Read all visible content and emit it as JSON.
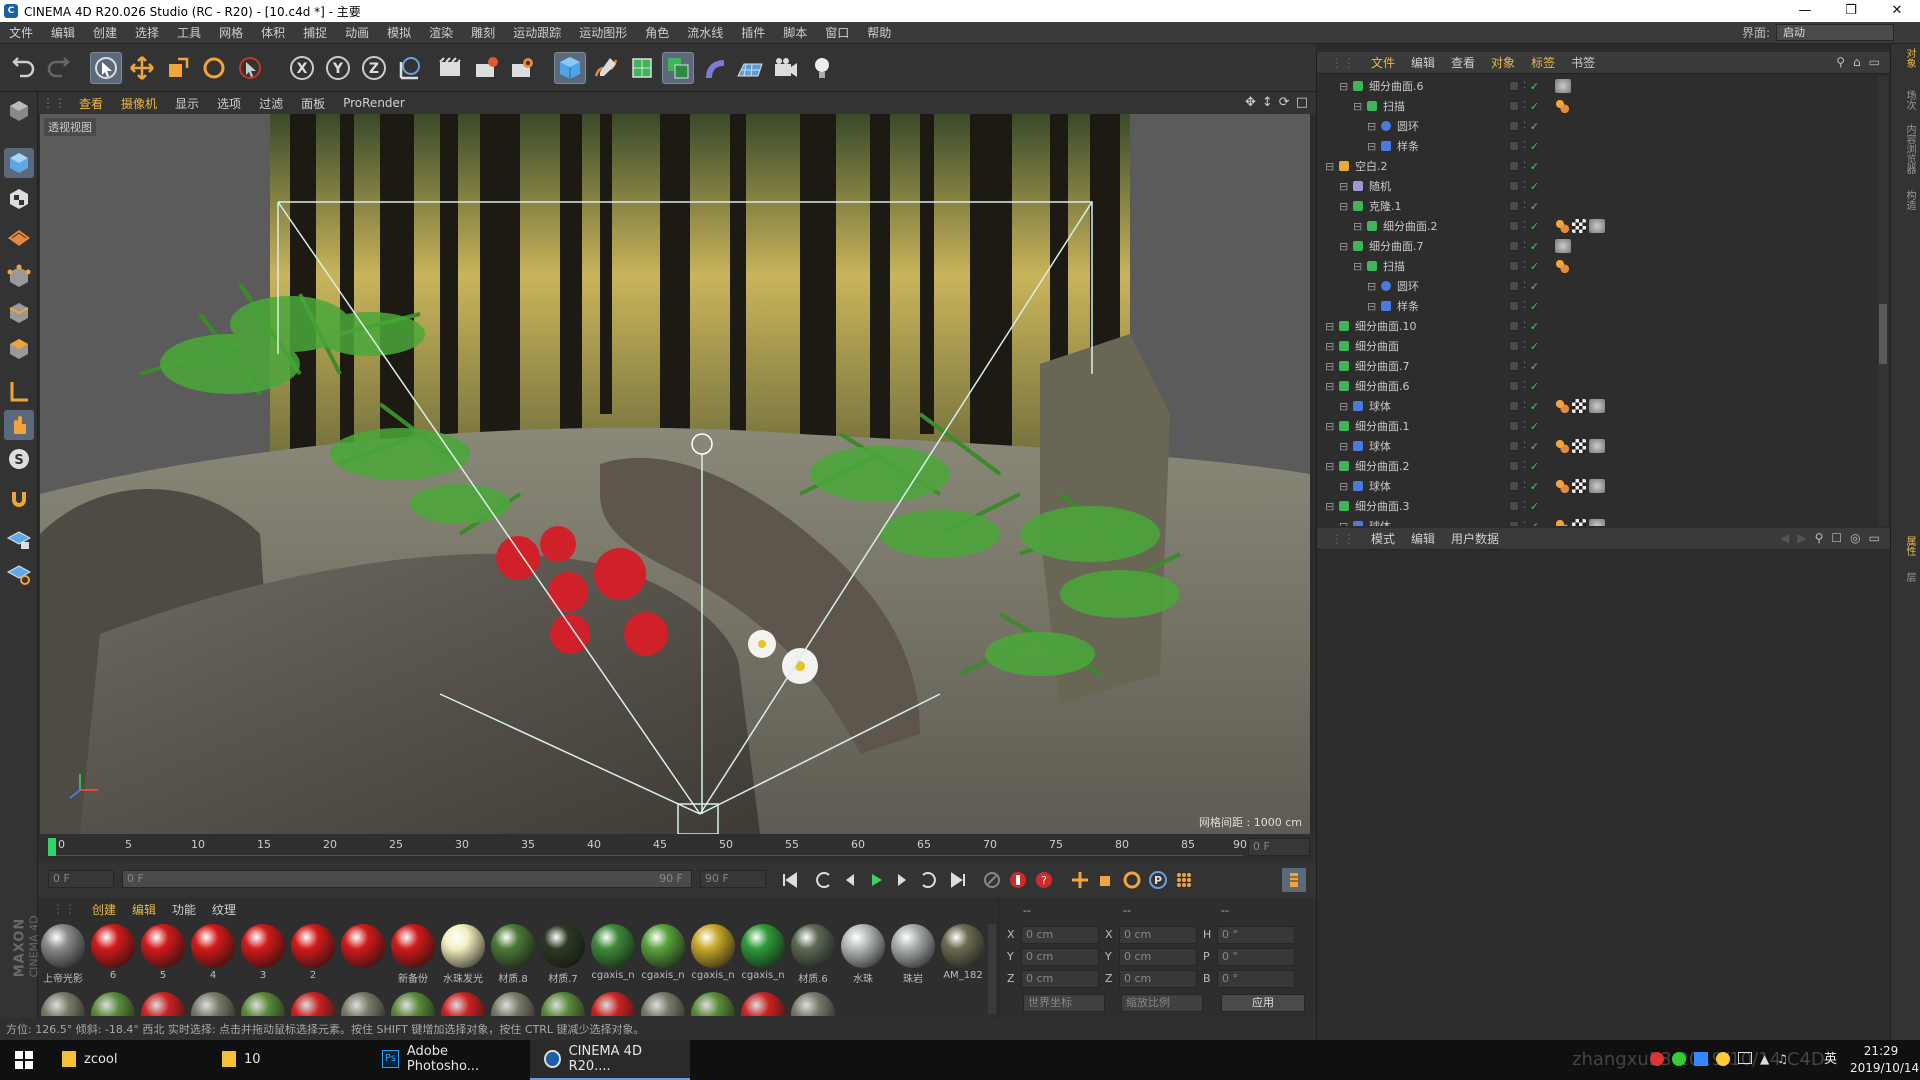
{
  "window": {
    "title": "CINEMA 4D R20.026 Studio (RC - R20) - [10.c4d *] - 主要"
  },
  "menubar": {
    "items": [
      "文件",
      "编辑",
      "创建",
      "选择",
      "工具",
      "网格",
      "体积",
      "捕捉",
      "动画",
      "模拟",
      "渲染",
      "雕刻",
      "运动跟踪",
      "运动图形",
      "角色",
      "流水线",
      "插件",
      "脚本",
      "窗口",
      "帮助"
    ],
    "layout_label": "界面:",
    "layout_value": "启动"
  },
  "viewport": {
    "menu": [
      "查看",
      "摄像机",
      "显示",
      "选项",
      "过滤",
      "面板",
      "ProRender"
    ],
    "label": "透视视图",
    "grid_info": "网格间距 : 1000 cm"
  },
  "timeline": {
    "ticks": [
      "0",
      "5",
      "10",
      "15",
      "20",
      "25",
      "30",
      "35",
      "40",
      "45",
      "50",
      "55",
      "60",
      "65",
      "70",
      "75",
      "80",
      "85",
      "90"
    ],
    "end_field": "0 F"
  },
  "transport": {
    "start_field": "0 F",
    "range_start": "0 F",
    "range_end": "90 F",
    "end_field": "90 F"
  },
  "materials": {
    "menu": [
      "创建",
      "编辑",
      "功能",
      "纹理"
    ],
    "items": [
      {
        "label": "上帝光影",
        "color": "#8a8a8a"
      },
      {
        "label": "6",
        "color": "#d21a1a"
      },
      {
        "label": "5",
        "color": "#d21a1a"
      },
      {
        "label": "4",
        "color": "#d21a1a"
      },
      {
        "label": "3",
        "color": "#d21a1a"
      },
      {
        "label": "2",
        "color": "#d21a1a"
      },
      {
        "label": "",
        "color": "#d21a1a"
      },
      {
        "label": "新备份",
        "color": "#d21a1a"
      },
      {
        "label": "水珠发光",
        "color": "#f4efc0"
      },
      {
        "label": "材质.8",
        "color": "#4c7a3a"
      },
      {
        "label": "材质.7",
        "color": "#2c3a22"
      },
      {
        "label": "cgaxis_n",
        "color": "#3f8a3a"
      },
      {
        "label": "cgaxis_n",
        "color": "#5aa33e"
      },
      {
        "label": "cgaxis_n",
        "color": "#c9a92a"
      },
      {
        "label": "cgaxis_n",
        "color": "#2f9a3a"
      },
      {
        "label": "材质.6",
        "color": "#5b6a55"
      },
      {
        "label": "水珠",
        "color": "#b8bcbc"
      },
      {
        "label": "珠岩",
        "color": "#a9b0b0"
      },
      {
        "label": "AM_182",
        "color": "#6e6a52"
      }
    ]
  },
  "coords": {
    "headers": [
      "--",
      "--",
      "--"
    ],
    "rows": [
      {
        "a": "X",
        "av": "0 cm",
        "b": "X",
        "bv": "0 cm",
        "c": "H",
        "cv": "0 °"
      },
      {
        "a": "Y",
        "av": "0 cm",
        "b": "Y",
        "bv": "0 cm",
        "c": "P",
        "cv": "0 °"
      },
      {
        "a": "Z",
        "av": "0 cm",
        "b": "Z",
        "bv": "0 cm",
        "c": "B",
        "cv": "0 °"
      }
    ],
    "world_label": "世界坐标",
    "scale_label": "缩放比例",
    "apply_label": "应用"
  },
  "statusline": {
    "text": "方位: 126.5°  倾斜: -18.4°  西北    实时选择: 点击并拖动鼠标选择元素。按住 SHIFT 键增加选择对象，按住 CTRL 键减少选择对象。"
  },
  "objects": {
    "menu": [
      "文件",
      "编辑",
      "查看",
      "对象",
      "标签",
      "书签"
    ],
    "rows": [
      {
        "name": "细分曲面.6",
        "depth": 1,
        "kind": "subdiv",
        "tags": [
          "phong-multi"
        ]
      },
      {
        "name": "扫描",
        "depth": 2,
        "kind": "sweep",
        "tags": [
          "tag-orange"
        ]
      },
      {
        "name": "圆环",
        "depth": 3,
        "kind": "circle",
        "tags": []
      },
      {
        "name": "样条",
        "depth": 3,
        "kind": "spline",
        "tags": []
      },
      {
        "name": "空白.2",
        "depth": 0,
        "kind": "null",
        "tags": []
      },
      {
        "name": "随机",
        "depth": 1,
        "kind": "random",
        "tags": []
      },
      {
        "name": "克隆.1",
        "depth": 1,
        "kind": "cloner",
        "tags": []
      },
      {
        "name": "细分曲面.2",
        "depth": 2,
        "kind": "subdiv",
        "tags": [
          "tag-orange",
          "tag-checker",
          "phong-multi"
        ]
      },
      {
        "name": "细分曲面.7",
        "depth": 1,
        "kind": "subdiv",
        "tags": [
          "phong-multi"
        ]
      },
      {
        "name": "扫描",
        "depth": 2,
        "kind": "sweep",
        "tags": [
          "tag-orange"
        ]
      },
      {
        "name": "圆环",
        "depth": 3,
        "kind": "circle",
        "tags": []
      },
      {
        "name": "样条",
        "depth": 3,
        "kind": "spline",
        "tags": []
      },
      {
        "name": "细分曲面.10",
        "depth": 0,
        "kind": "subdiv",
        "tags": []
      },
      {
        "name": "细分曲面",
        "depth": 0,
        "kind": "subdiv",
        "tags": []
      },
      {
        "name": "细分曲面.7",
        "depth": 0,
        "kind": "subdiv",
        "tags": []
      },
      {
        "name": "细分曲面.6",
        "depth": 0,
        "kind": "subdiv",
        "tags": []
      },
      {
        "name": "球体",
        "depth": 1,
        "kind": "sphere",
        "tags": [
          "tag-orange",
          "tag-checker",
          "phong-multi"
        ]
      },
      {
        "name": "细分曲面.1",
        "depth": 0,
        "kind": "subdiv",
        "tags": []
      },
      {
        "name": "球体",
        "depth": 1,
        "kind": "sphere",
        "tags": [
          "tag-orange",
          "tag-checker",
          "phong-multi"
        ]
      },
      {
        "name": "细分曲面.2",
        "depth": 0,
        "kind": "subdiv",
        "tags": []
      },
      {
        "name": "球体",
        "depth": 1,
        "kind": "sphere",
        "tags": [
          "tag-orange",
          "tag-checker",
          "phong-multi"
        ]
      },
      {
        "name": "细分曲面.3",
        "depth": 0,
        "kind": "subdiv",
        "tags": []
      },
      {
        "name": "球体",
        "depth": 1,
        "kind": "sphere",
        "tags": [
          "tag-orange",
          "tag-checker",
          "phong-multi"
        ]
      }
    ]
  },
  "attributes": {
    "menu": [
      "模式",
      "编辑",
      "用户数据"
    ]
  },
  "rightstrip": {
    "tabs": [
      "对象",
      "场次",
      "内容浏览器",
      "构造"
    ],
    "tabs2": [
      "属性",
      "层"
    ]
  },
  "brand": {
    "line1": "MAXON",
    "line2": "CINEMA 4D"
  },
  "taskbar": {
    "items": [
      {
        "label": "zcool",
        "icon": "folder-icon"
      },
      {
        "label": "10",
        "icon": "folder-icon"
      },
      {
        "label": "Adobe Photosho...",
        "icon": "photoshop-icon"
      },
      {
        "label": "CINEMA 4D R20....",
        "icon": "c4d-icon"
      }
    ],
    "watermark": "zhangxu53  2019/10/14 C4D",
    "time": "21:29",
    "date": "2019/10/14",
    "ime": "英"
  },
  "colors": {
    "accent": "#e8b84a",
    "panel": "#2d2d2d",
    "select": "#5a6a7a"
  }
}
